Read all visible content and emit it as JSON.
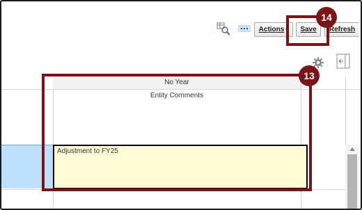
{
  "toolbar": {
    "icons": [
      "search-grid-icon",
      "more-icon"
    ],
    "actions_label": "Actions",
    "actions_chevron": "▾",
    "save_label": "Save",
    "refresh_label": "Refresh"
  },
  "subbar": {
    "icons": [
      "gear-icon",
      "panel-toggle-icon"
    ]
  },
  "grid": {
    "column_header_1": "No Year",
    "column_header_2": "Entity Comments",
    "cell_value": "Adjustment to FY25"
  },
  "callouts": {
    "save_step": "14",
    "grid_step": "13",
    "accent_color": "#7b1416"
  },
  "colors": {
    "cell_fill": "#fefcd6",
    "row_highlight": "#bfe0fb"
  }
}
